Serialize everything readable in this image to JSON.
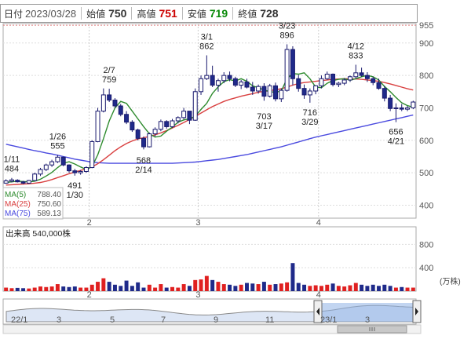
{
  "header": {
    "date_label": "日付",
    "date": "2023/03/28",
    "open_label": "始値",
    "open": "750",
    "high_label": "高値",
    "high": "751",
    "low_label": "安値",
    "low": "719",
    "close_label": "終値",
    "close": "728",
    "colors": {
      "high": "#cc0000",
      "low": "#0a8a0a",
      "neutral": "#222222"
    }
  },
  "legend": [
    {
      "label": "MA(5)",
      "value": "788.40",
      "color": "#2e8b2e"
    },
    {
      "label": "MA(25)",
      "value": "750.60",
      "color": "#d94040"
    },
    {
      "label": "MA(75)",
      "value": "589.13",
      "color": "#4a4adf"
    }
  ],
  "volume_label": "出来高  540,000株",
  "volume_unit": "(万株)",
  "navigator_labels": [
    "22/1",
    "3",
    "5",
    "7",
    "9",
    "11",
    "23/1",
    "3"
  ],
  "chart_data": [
    {
      "type": "candlestick",
      "title": "",
      "ylim": [
        360,
        960
      ],
      "yticks": [
        400,
        500,
        600,
        700,
        800,
        900
      ],
      "ymax_label": "955",
      "month_ticks": [
        {
          "label": "2",
          "index": 15
        },
        {
          "label": "3",
          "index": 34
        },
        {
          "label": "4",
          "index": 55
        }
      ],
      "candles": [
        [
          468,
          480,
          466,
          475
        ],
        [
          474,
          484,
          470,
          478
        ],
        [
          477,
          480,
          470,
          472
        ],
        [
          472,
          475,
          465,
          468
        ],
        [
          468,
          478,
          466,
          476
        ],
        [
          476,
          500,
          474,
          496
        ],
        [
          496,
          515,
          490,
          510
        ],
        [
          510,
          528,
          505,
          524
        ],
        [
          524,
          540,
          518,
          534
        ],
        [
          534,
          555,
          530,
          548
        ],
        [
          548,
          550,
          520,
          524
        ],
        [
          524,
          526,
          500,
          506
        ],
        [
          506,
          512,
          491,
          500
        ],
        [
          500,
          508,
          494,
          504
        ],
        [
          504,
          520,
          500,
          516
        ],
        [
          516,
          600,
          514,
          596
        ],
        [
          596,
          700,
          594,
          690
        ],
        [
          690,
          760,
          686,
          740
        ],
        [
          740,
          759,
          718,
          724
        ],
        [
          724,
          730,
          700,
          706
        ],
        [
          706,
          712,
          674,
          680
        ],
        [
          680,
          690,
          650,
          656
        ],
        [
          656,
          662,
          626,
          632
        ],
        [
          632,
          636,
          600,
          606
        ],
        [
          606,
          612,
          572,
          580
        ],
        [
          580,
          624,
          578,
          620
        ],
        [
          620,
          640,
          612,
          634
        ],
        [
          634,
          664,
          628,
          658
        ],
        [
          658,
          662,
          636,
          642
        ],
        [
          642,
          666,
          638,
          660
        ],
        [
          660,
          674,
          652,
          670
        ],
        [
          670,
          700,
          664,
          690
        ],
        [
          690,
          680,
          650,
          662
        ],
        [
          662,
          760,
          660,
          750
        ],
        [
          750,
          800,
          740,
          790
        ],
        [
          790,
          862,
          786,
          800
        ],
        [
          800,
          830,
          764,
          770
        ],
        [
          770,
          790,
          750,
          784
        ],
        [
          784,
          810,
          776,
          800
        ],
        [
          800,
          812,
          782,
          790
        ],
        [
          790,
          796,
          764,
          770
        ],
        [
          770,
          786,
          758,
          780
        ],
        [
          780,
          790,
          760,
          764
        ],
        [
          764,
          780,
          740,
          752
        ],
        [
          752,
          772,
          744,
          766
        ],
        [
          766,
          776,
          722,
          736
        ],
        [
          736,
          774,
          732,
          768
        ],
        [
          768,
          778,
          720,
          728
        ],
        [
          728,
          760,
          718,
          754
        ],
        [
          754,
          896,
          750,
          880
        ],
        [
          880,
          890,
          770,
          790
        ],
        [
          790,
          802,
          750,
          760
        ],
        [
          760,
          772,
          728,
          740
        ],
        [
          740,
          760,
          716,
          752
        ],
        [
          752,
          770,
          742,
          768
        ],
        [
          768,
          800,
          760,
          790
        ],
        [
          790,
          812,
          786,
          804
        ],
        [
          804,
          806,
          766,
          772
        ],
        [
          772,
          780,
          764,
          776
        ],
        [
          776,
          792,
          770,
          786
        ],
        [
          786,
          800,
          780,
          796
        ],
        [
          796,
          833,
          790,
          808
        ],
        [
          808,
          824,
          796,
          800
        ],
        [
          800,
          810,
          780,
          790
        ],
        [
          790,
          796,
          770,
          778
        ],
        [
          778,
          790,
          756,
          760
        ],
        [
          760,
          768,
          720,
          730
        ],
        [
          730,
          740,
          690,
          698
        ],
        [
          698,
          714,
          656,
          700
        ],
        [
          700,
          712,
          690,
          696
        ],
        [
          696,
          706,
          690,
          700
        ],
        [
          700,
          722,
          696,
          718
        ]
      ],
      "ma5": [
        470,
        472,
        474,
        473,
        472,
        474,
        480,
        490,
        501,
        516,
        529,
        534,
        527,
        518,
        510,
        519,
        555,
        605,
        660,
        700,
        720,
        714,
        690,
        666,
        642,
        620,
        610,
        613,
        628,
        641,
        656,
        663,
        666,
        674,
        695,
        714,
        745,
        765,
        781,
        787,
        783,
        790,
        782,
        768,
        762,
        755,
        750,
        748,
        752,
        790,
        806,
        804,
        808,
        790,
        764,
        762,
        776,
        784,
        788,
        790,
        785,
        790,
        796,
        800,
        796,
        786,
        766,
        750,
        732,
        716,
        707,
        702
      ],
      "ma25": [
        462,
        463,
        464,
        465,
        466,
        468,
        470,
        474,
        479,
        485,
        491,
        497,
        502,
        507,
        512,
        518,
        528,
        540,
        554,
        568,
        580,
        590,
        598,
        604,
        608,
        612,
        617,
        623,
        630,
        638,
        646,
        655,
        664,
        674,
        684,
        694,
        704,
        712,
        720,
        726,
        731,
        736,
        740,
        744,
        748,
        751,
        753,
        756,
        759,
        764,
        770,
        775,
        778,
        780,
        782,
        784,
        786,
        788,
        789,
        790,
        790,
        789,
        788,
        786,
        784,
        782,
        778,
        774,
        769,
        764,
        759,
        755
      ],
      "ma75": [
        588,
        584,
        580,
        576,
        572,
        568,
        565,
        561,
        558,
        554,
        550,
        546,
        542,
        539,
        536,
        533,
        531,
        530,
        529,
        529,
        529,
        529,
        529,
        529,
        529,
        529,
        529,
        529,
        529,
        529,
        530,
        531,
        532,
        533,
        535,
        537,
        539,
        541,
        544,
        547,
        550,
        553,
        556,
        560,
        564,
        568,
        572,
        576,
        580,
        585,
        590,
        595,
        600,
        605,
        610,
        614,
        618,
        622,
        626,
        630,
        634,
        638,
        642,
        646,
        650,
        654,
        658,
        662,
        666,
        670,
        674,
        678
      ],
      "annotations": [
        {
          "index": 1,
          "price": 484,
          "date": "1/11",
          "pos": "above"
        },
        {
          "index": 9,
          "price": 555,
          "date": "1/26",
          "pos": "above"
        },
        {
          "index": 12,
          "price": 491,
          "date": "1/30",
          "pos": "below"
        },
        {
          "index": 18,
          "price": 759,
          "date": "2/7",
          "pos": "above"
        },
        {
          "index": 24,
          "price": 568,
          "date": "2/14",
          "pos": "below"
        },
        {
          "index": 35,
          "price": 862,
          "date": "3/1",
          "pos": "above"
        },
        {
          "index": 49,
          "price": 896,
          "date": "3/23",
          "pos": "above"
        },
        {
          "index": 45,
          "price": 703,
          "date": "3/17",
          "pos": "below"
        },
        {
          "index": 53,
          "price": 716,
          "date": "3/29",
          "pos": "below"
        },
        {
          "index": 61,
          "price": 833,
          "date": "4/12",
          "pos": "above"
        },
        {
          "index": 68,
          "price": 656,
          "date": "4/21",
          "pos": "below"
        }
      ]
    },
    {
      "type": "bar",
      "title": "出来高",
      "ylim": [
        0,
        1100
      ],
      "yticks": [
        400,
        800
      ],
      "volumes": [
        60,
        50,
        55,
        50,
        45,
        60,
        80,
        70,
        80,
        120,
        80,
        70,
        80,
        60,
        60,
        110,
        160,
        220,
        160,
        110,
        90,
        180,
        90,
        150,
        60,
        110,
        60,
        120,
        60,
        70,
        60,
        120,
        90,
        190,
        200,
        260,
        190,
        160,
        120,
        110,
        90,
        110,
        140,
        130,
        120,
        160,
        110,
        120,
        130,
        150,
        480,
        140,
        110,
        90,
        100,
        90,
        110,
        130,
        90,
        80,
        100,
        140,
        110,
        90,
        110,
        90,
        110,
        90,
        60,
        70,
        60,
        60
      ]
    }
  ]
}
